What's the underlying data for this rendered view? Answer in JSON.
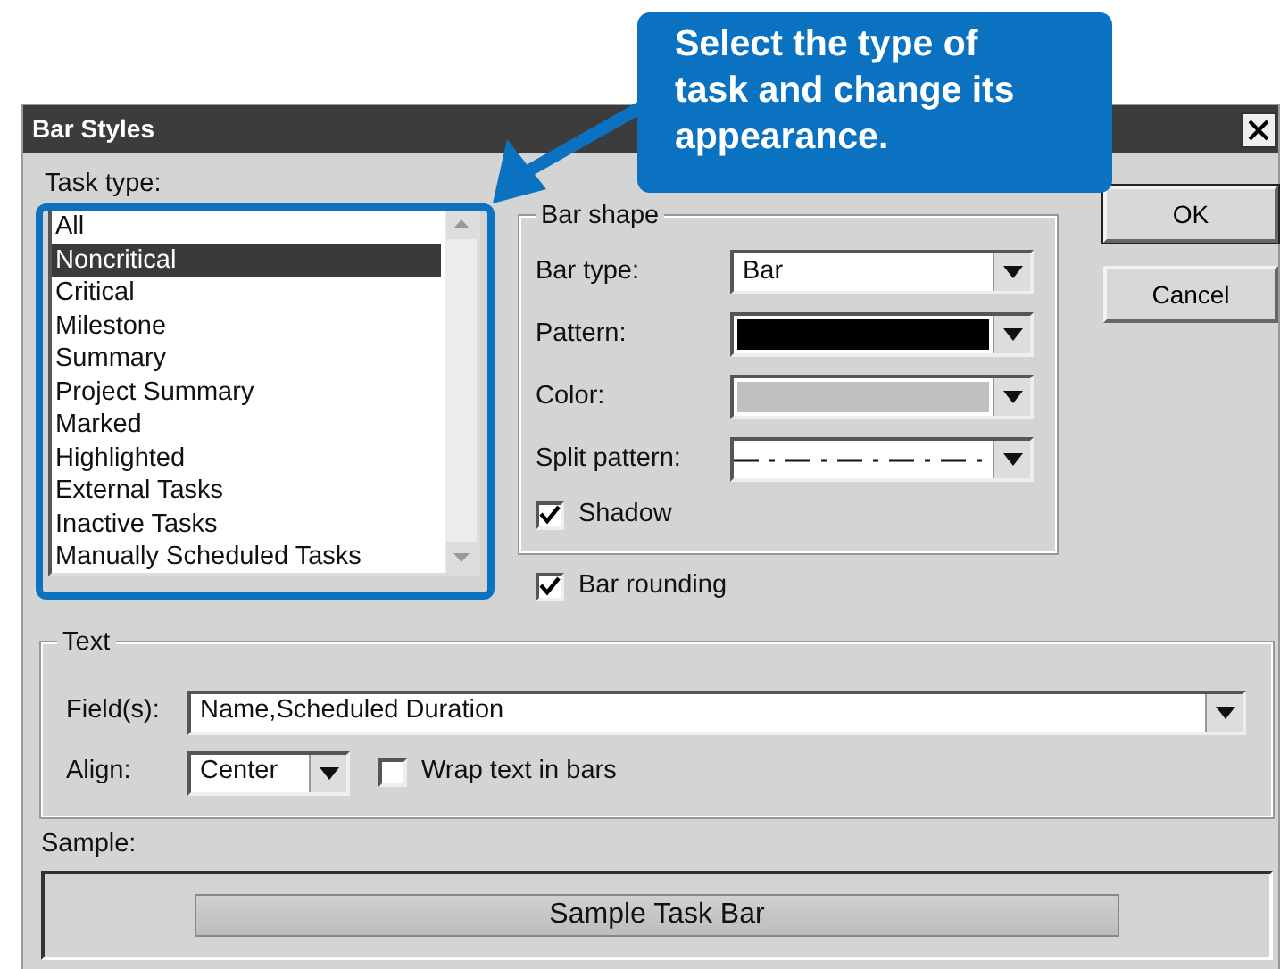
{
  "window": {
    "title": "Bar Styles"
  },
  "callout": {
    "text": "Select the type of task and change its appearance."
  },
  "task_type": {
    "label": "Task type:",
    "items": [
      {
        "label": "All",
        "selected": false
      },
      {
        "label": "Noncritical",
        "selected": true
      },
      {
        "label": "Critical",
        "selected": false
      },
      {
        "label": "Milestone",
        "selected": false
      },
      {
        "label": "Summary",
        "selected": false
      },
      {
        "label": "Project Summary",
        "selected": false
      },
      {
        "label": "Marked",
        "selected": false
      },
      {
        "label": "Highlighted",
        "selected": false
      },
      {
        "label": "External Tasks",
        "selected": false
      },
      {
        "label": "Inactive Tasks",
        "selected": false
      },
      {
        "label": "Manually Scheduled Tasks",
        "selected": false
      }
    ]
  },
  "bar_shape": {
    "legend": "Bar shape",
    "fields": [
      {
        "kind": "text",
        "label": "Bar type:",
        "value": "Bar"
      },
      {
        "kind": "swatch",
        "label": "Pattern:",
        "color": "#000000"
      },
      {
        "kind": "swatch",
        "label": "Color:",
        "color": "#c0c0c0"
      },
      {
        "kind": "dashes",
        "label": "Split pattern:"
      }
    ],
    "shadow": {
      "label": "Shadow",
      "checked": true
    }
  },
  "bar_rounding": {
    "label": "Bar rounding",
    "checked": true
  },
  "buttons": [
    {
      "label": "OK",
      "default": true
    },
    {
      "label": "Cancel",
      "default": false
    }
  ],
  "text_group": {
    "legend": "Text",
    "fields": {
      "label": "Field(s):",
      "value": "Name,Scheduled Duration"
    },
    "align": {
      "label": "Align:",
      "value": "Center"
    },
    "wrap": {
      "label": "Wrap text in bars",
      "checked": false
    }
  },
  "sample": {
    "label": "Sample:",
    "bar_text": "Sample Task Bar"
  }
}
